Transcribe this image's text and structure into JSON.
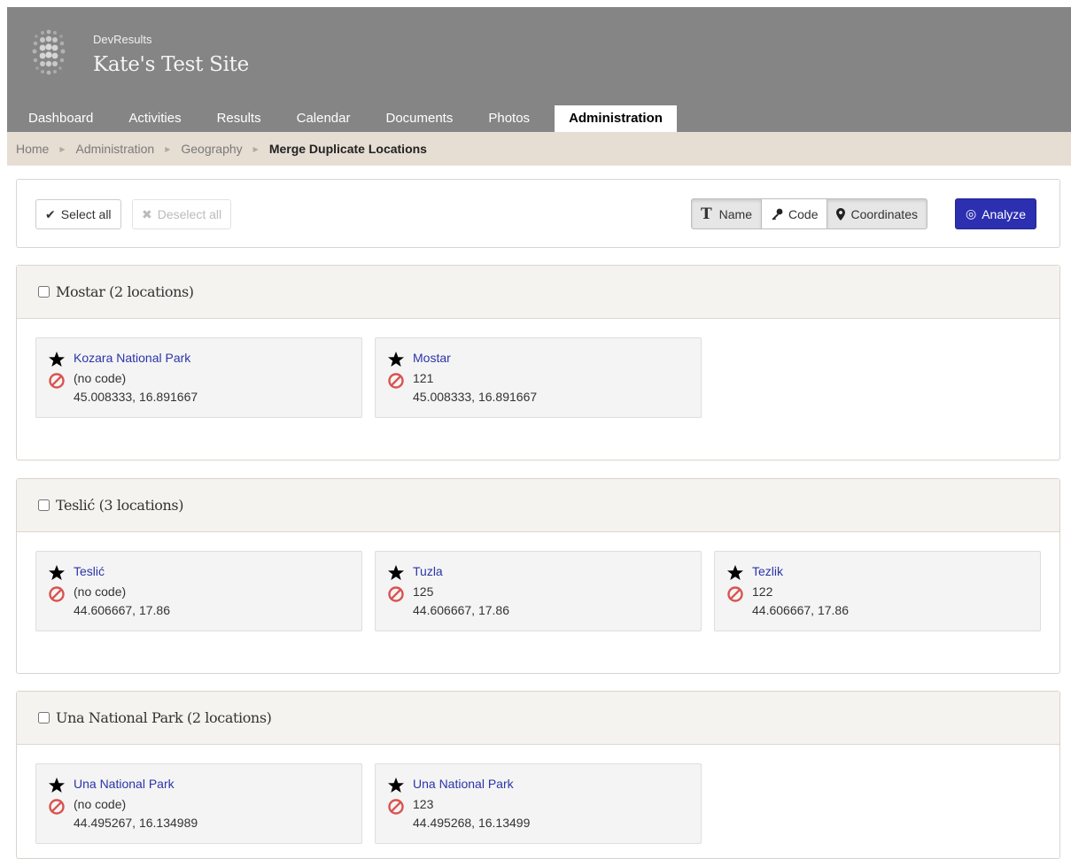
{
  "app": {
    "brand_small": "DevResults",
    "site_title": "Kate's Test Site"
  },
  "nav": {
    "items": [
      "Dashboard",
      "Activities",
      "Results",
      "Calendar",
      "Documents",
      "Photos"
    ],
    "active": "Administration"
  },
  "breadcrumb": [
    "Home",
    "Administration",
    "Geography",
    "Merge Duplicate Locations"
  ],
  "toolbar": {
    "select_all": "Select all",
    "deselect_all": "Deselect all",
    "match_name": "Name",
    "match_code": "Code",
    "match_coordinates": "Coordinates",
    "analyze": "Analyze"
  },
  "colors": {
    "header_bg": "#858585",
    "breadcrumb_bg": "#e6ddd3",
    "accent": "#2b2fb0",
    "link": "#2b34a8",
    "block_icon": "#d9534f"
  },
  "groups": [
    {
      "title": "Mostar (2 locations)",
      "locations": [
        {
          "name": "Kozara National Park",
          "code": "(no code)",
          "coords": "45.008333, 16.891667"
        },
        {
          "name": "Mostar",
          "code": "121",
          "coords": "45.008333, 16.891667"
        }
      ]
    },
    {
      "title": "Teslić (3 locations)",
      "locations": [
        {
          "name": "Teslić",
          "code": "(no code)",
          "coords": "44.606667, 17.86"
        },
        {
          "name": "Tuzla",
          "code": "125",
          "coords": "44.606667, 17.86"
        },
        {
          "name": "Tezlik",
          "code": "122",
          "coords": "44.606667, 17.86"
        }
      ]
    },
    {
      "title": "Una National Park (2 locations)",
      "locations": [
        {
          "name": "Una National Park",
          "code": "(no code)",
          "coords": "44.495267, 16.134989"
        },
        {
          "name": "Una National Park",
          "code": "123",
          "coords": "44.495268, 16.13499"
        }
      ]
    }
  ]
}
